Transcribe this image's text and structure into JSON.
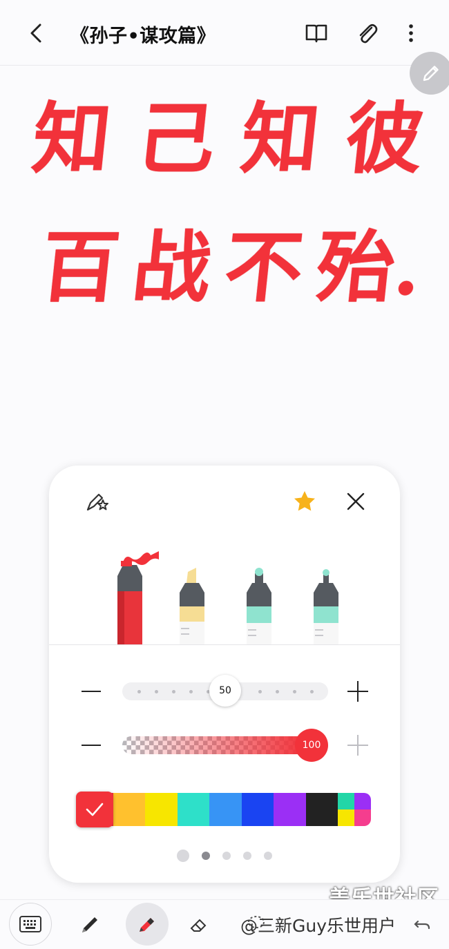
{
  "header": {
    "title": "《孙子•谋攻篇》",
    "back_icon": "back-arrow-icon",
    "icons": [
      "book-icon",
      "paperclip-icon",
      "more-vertical-icon"
    ]
  },
  "note": {
    "line1": [
      "知",
      "己",
      "知",
      "彼"
    ],
    "line2": [
      "百",
      "战",
      "不",
      "殆."
    ],
    "ink_color": "#f2323a"
  },
  "pen_panel": {
    "pens": [
      {
        "name": "marker",
        "color": "#f2323a",
        "selected": true
      },
      {
        "name": "highlighter",
        "color": "#f6dd94",
        "selected": false
      },
      {
        "name": "pen-mint-1",
        "color": "#8fe3cf",
        "selected": false
      },
      {
        "name": "pen-mint-2",
        "color": "#8fe3cf",
        "selected": false
      }
    ],
    "size_value": "50",
    "size_level": 0.5,
    "opacity_value": "100",
    "opacity_level": 1.0,
    "palette": [
      "#f2323a",
      "#ffc12e",
      "#f7e600",
      "#2ee0c9",
      "#3794f5",
      "#1a44f2",
      "#9b2ff5",
      "#222222"
    ],
    "palette_mini": [
      "#22d6a7",
      "#9b2ff5",
      "#f7e600",
      "#f53d8e"
    ],
    "selected_color": "#f2323a",
    "pages": 5,
    "active_page": 1
  },
  "toolbar": {
    "items": [
      "keyboard-icon",
      "pen-icon",
      "highlighter-icon",
      "eraser-icon",
      "lasso-icon",
      "undo-icon"
    ]
  },
  "watermark": {
    "line1": "盖乐世社区",
    "line2": "@三新Guy乐世用户"
  }
}
